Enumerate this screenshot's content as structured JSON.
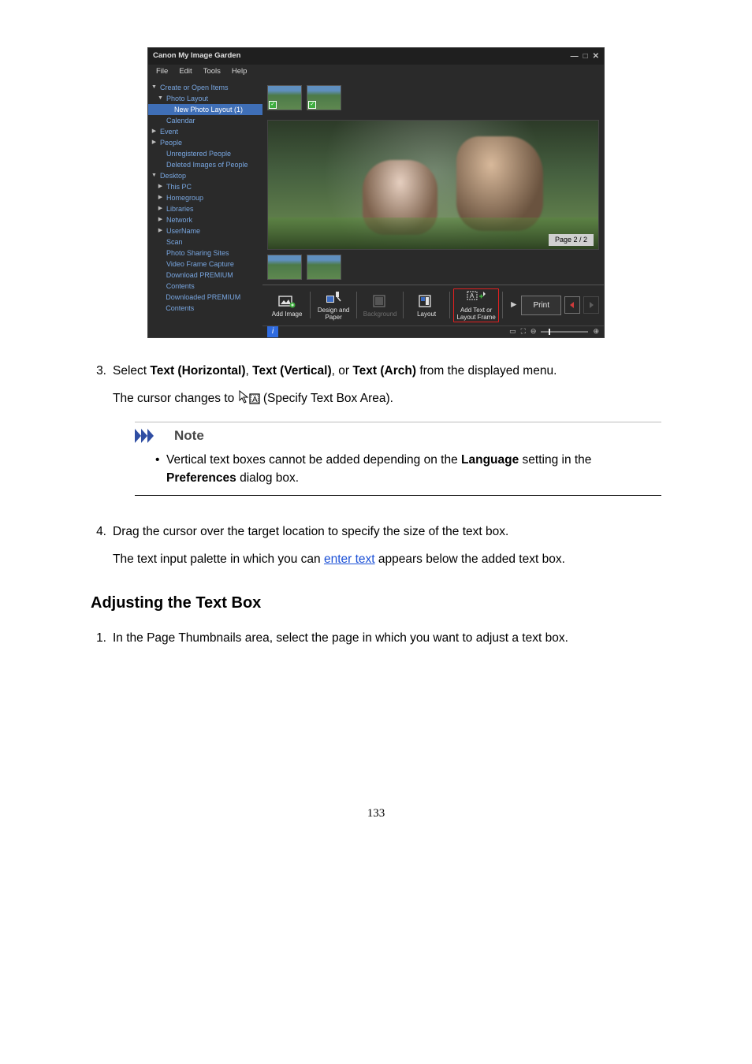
{
  "app": {
    "title": "Canon My Image Garden",
    "menu": {
      "file": "File",
      "edit": "Edit",
      "tools": "Tools",
      "help": "Help"
    },
    "tree": {
      "create": "Create or Open Items",
      "photoLayout": "Photo Layout",
      "newPhotoLayout": "New Photo Layout (1)",
      "calendar": "Calendar",
      "event": "Event",
      "people": "People",
      "unregistered": "Unregistered People",
      "deleted": "Deleted Images of People",
      "desktop": "Desktop",
      "thisPC": "This PC",
      "homegroup": "Homegroup",
      "libraries": "Libraries",
      "network": "Network",
      "userName": "UserName",
      "scan": "Scan",
      "sharing": "Photo Sharing Sites",
      "video": "Video Frame Capture",
      "dlprem": "Download PREMIUM Contents",
      "dledprem": "Downloaded PREMIUM Contents"
    },
    "pageLabel": "Page 2 / 2",
    "toolbar": {
      "addImage": "Add Image",
      "designPaper": "Design and Paper",
      "background": "Background",
      "layout": "Layout",
      "addText": "Add Text or Layout Frame"
    },
    "print": "Print"
  },
  "step3": {
    "num": "3.",
    "lead_a": "Select ",
    "th": "Text (Horizontal)",
    "sep1": ", ",
    "tv": "Text (Vertical)",
    "sep2": ", or ",
    "ta": "Text (Arch)",
    "lead_b": " from the displayed menu.",
    "cursor_a": "The cursor changes to ",
    "cursor_b": " (Specify Text Box Area)."
  },
  "note": {
    "label": "Note",
    "text_a": "Vertical text boxes cannot be added depending on the ",
    "lang": "Language",
    "text_b": " setting in the ",
    "pref": "Preferences",
    "text_c": " dialog box."
  },
  "step4": {
    "num": "4.",
    "line1": "Drag the cursor over the target location to specify the size of the text box.",
    "line2a": "The text input palette in which you can ",
    "link": "enter text",
    "line2b": " appears below the added text box."
  },
  "section": "Adjusting the Text Box",
  "step1b": {
    "num": "1.",
    "text": "In the Page Thumbnails area, select the page in which you want to adjust a text box."
  },
  "pageNumber": "133"
}
